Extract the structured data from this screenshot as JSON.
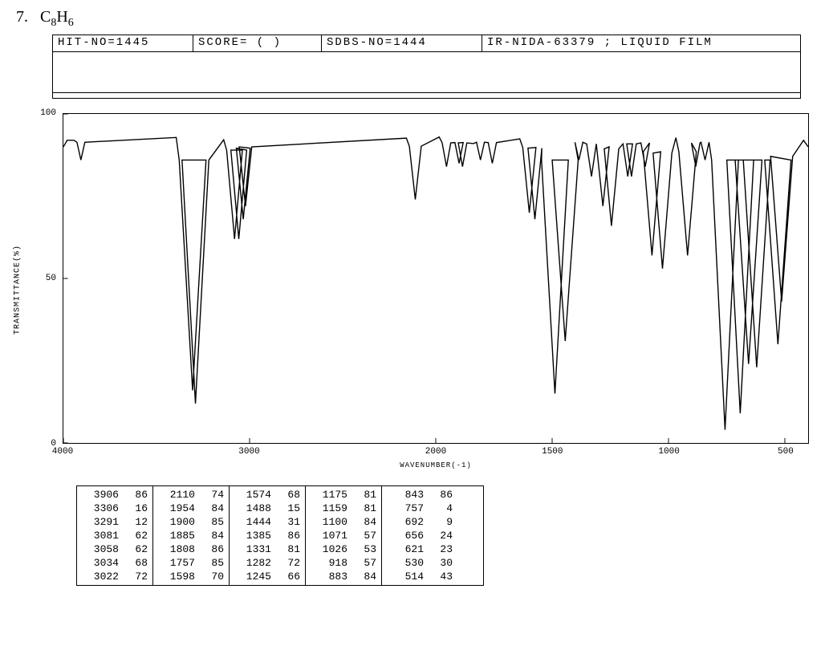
{
  "question_num": "7.",
  "formula_html": "C<sub>8</sub>H<sub>6</sub>",
  "header": {
    "hit_no": "HIT-NO=1445",
    "score": "SCORE=   (   )",
    "sdbs_no": "SDBS-NO=1444",
    "ir_info": "IR-NIDA-63379 ; LIQUID FILM"
  },
  "chart_data": {
    "type": "line",
    "title": "",
    "xlabel": "WAVENUMBER(-1)",
    "ylabel": "TRANSMITTANCE(%)",
    "xlim": [
      4000,
      400
    ],
    "ylim": [
      0,
      100
    ],
    "x_ticks": [
      4000,
      3000,
      2000,
      1500,
      1000,
      500
    ],
    "y_ticks": [
      0,
      50,
      100
    ],
    "peaks": [
      {
        "wn": 3906,
        "t": 86
      },
      {
        "wn": 3306,
        "t": 16
      },
      {
        "wn": 3291,
        "t": 12
      },
      {
        "wn": 3081,
        "t": 62
      },
      {
        "wn": 3058,
        "t": 62
      },
      {
        "wn": 3034,
        "t": 68
      },
      {
        "wn": 3022,
        "t": 72
      },
      {
        "wn": 2110,
        "t": 74
      },
      {
        "wn": 1954,
        "t": 84
      },
      {
        "wn": 1900,
        "t": 85
      },
      {
        "wn": 1885,
        "t": 84
      },
      {
        "wn": 1808,
        "t": 86
      },
      {
        "wn": 1757,
        "t": 85
      },
      {
        "wn": 1598,
        "t": 70
      },
      {
        "wn": 1574,
        "t": 68
      },
      {
        "wn": 1488,
        "t": 15
      },
      {
        "wn": 1444,
        "t": 31
      },
      {
        "wn": 1385,
        "t": 86
      },
      {
        "wn": 1331,
        "t": 81
      },
      {
        "wn": 1282,
        "t": 72
      },
      {
        "wn": 1245,
        "t": 66
      },
      {
        "wn": 1175,
        "t": 81
      },
      {
        "wn": 1159,
        "t": 81
      },
      {
        "wn": 1100,
        "t": 84
      },
      {
        "wn": 1071,
        "t": 57
      },
      {
        "wn": 1026,
        "t": 53
      },
      {
        "wn": 918,
        "t": 57
      },
      {
        "wn": 883,
        "t": 84
      },
      {
        "wn": 843,
        "t": 86
      },
      {
        "wn": 757,
        "t": 4
      },
      {
        "wn": 692,
        "t": 9
      },
      {
        "wn": 656,
        "t": 24
      },
      {
        "wn": 621,
        "t": 23
      },
      {
        "wn": 530,
        "t": 30
      },
      {
        "wn": 514,
        "t": 43
      }
    ],
    "baseline": 92
  },
  "peak_table": [
    [
      [
        3906,
        86
      ],
      [
        3306,
        16
      ],
      [
        3291,
        12
      ],
      [
        3081,
        62
      ],
      [
        3058,
        62
      ],
      [
        3034,
        68
      ],
      [
        3022,
        72
      ]
    ],
    [
      [
        2110,
        74
      ],
      [
        1954,
        84
      ],
      [
        1900,
        85
      ],
      [
        1885,
        84
      ],
      [
        1808,
        86
      ],
      [
        1757,
        85
      ],
      [
        1598,
        70
      ]
    ],
    [
      [
        1574,
        68
      ],
      [
        1488,
        15
      ],
      [
        1444,
        31
      ],
      [
        1385,
        86
      ],
      [
        1331,
        81
      ],
      [
        1282,
        72
      ],
      [
        1245,
        66
      ]
    ],
    [
      [
        1175,
        81
      ],
      [
        1159,
        81
      ],
      [
        1100,
        84
      ],
      [
        1071,
        57
      ],
      [
        1026,
        53
      ],
      [
        918,
        57
      ],
      [
        883,
        84
      ]
    ],
    [
      [
        843,
        86
      ],
      [
        757,
        4
      ],
      [
        692,
        9
      ],
      [
        656,
        24
      ],
      [
        621,
        23
      ],
      [
        530,
        30
      ],
      [
        514,
        43
      ]
    ]
  ]
}
